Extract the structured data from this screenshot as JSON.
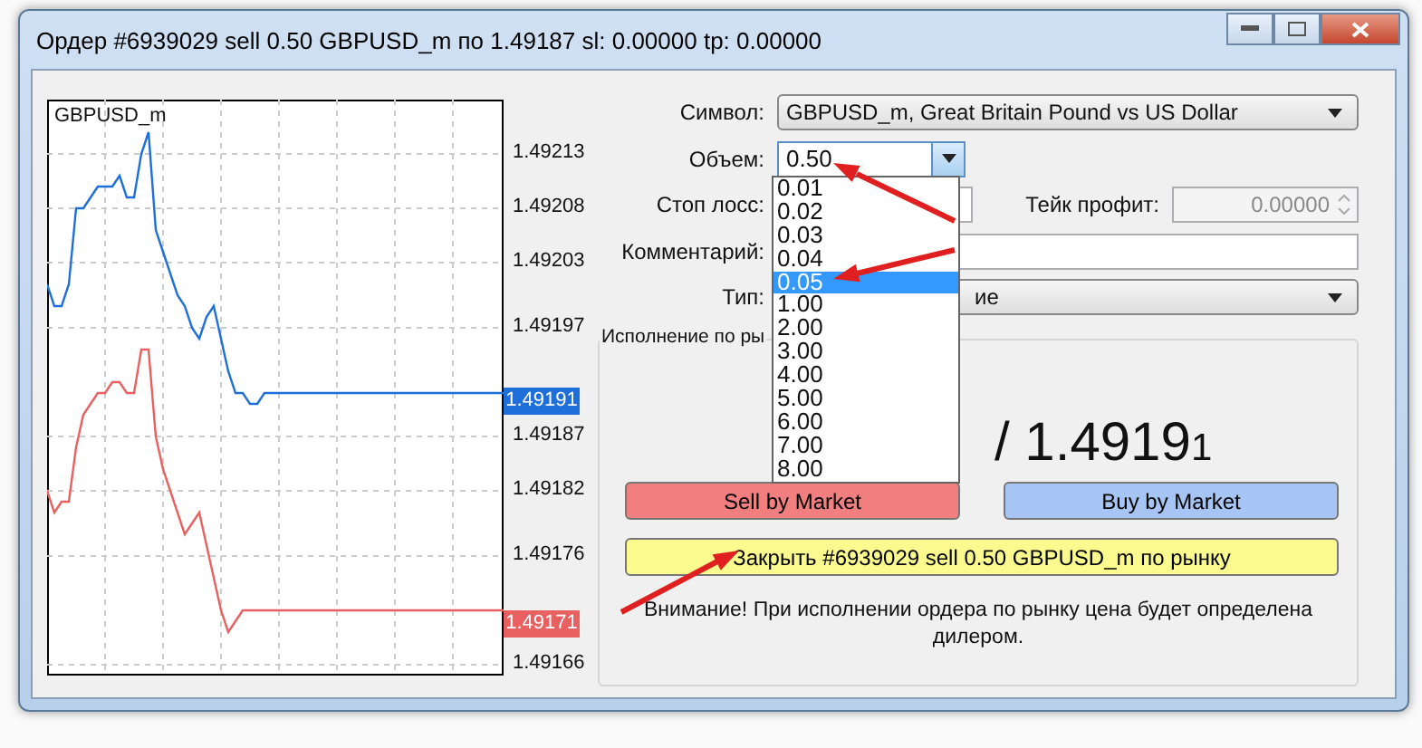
{
  "window": {
    "title": "Ордер #6939029 sell 0.50 GBPUSD_m по 1.49187 sl: 0.00000 tp: 0.00000"
  },
  "chart": {
    "symbol": "GBPUSD_m",
    "chart_data": {
      "type": "line",
      "grid": true,
      "ylim": [
        1.49165,
        1.49218
      ],
      "yticks": [
        {
          "value": 1.49213,
          "label": "1.49213"
        },
        {
          "value": 1.49208,
          "label": "1.49208"
        },
        {
          "value": 1.49203,
          "label": "1.49203"
        },
        {
          "value": 1.49197,
          "label": "1.49197"
        },
        {
          "value": 1.49187,
          "label": "1.49187"
        },
        {
          "value": 1.49182,
          "label": "1.49182"
        },
        {
          "value": 1.49176,
          "label": "1.49176"
        },
        {
          "value": 1.49166,
          "label": "1.49166"
        }
      ],
      "series": [
        {
          "color": "#1e6fd9",
          "values": [
            1.49201,
            1.49199,
            1.49199,
            1.49201,
            1.49208,
            1.49208,
            1.49209,
            1.4921,
            1.4921,
            1.4921,
            1.49211,
            1.49209,
            1.49209,
            1.49213,
            1.49215,
            1.49206,
            1.49204,
            1.49202,
            1.492,
            1.49199,
            1.49197,
            1.49196,
            1.49198,
            1.49199,
            1.49196,
            1.49193,
            1.49191,
            1.49191,
            1.4919,
            1.4919,
            1.49191,
            1.49191,
            1.49191,
            1.49191,
            1.49191,
            1.49191,
            1.49191,
            1.49191,
            1.49191,
            1.49191,
            1.49191,
            1.49191,
            1.49191,
            1.49191,
            1.49191,
            1.49191,
            1.49191,
            1.49191,
            1.49191,
            1.49191,
            1.49191,
            1.49191,
            1.49191,
            1.49191,
            1.49191,
            1.49191,
            1.49191,
            1.49191,
            1.49191,
            1.49191,
            1.49191,
            1.49191,
            1.49191,
            1.49191
          ]
        },
        {
          "color": "#e86060",
          "values": [
            1.49182,
            1.4918,
            1.49181,
            1.49181,
            1.49186,
            1.49189,
            1.4919,
            1.49191,
            1.49191,
            1.49192,
            1.49192,
            1.49191,
            1.49191,
            1.49195,
            1.49195,
            1.49187,
            1.49184,
            1.49182,
            1.4918,
            1.49178,
            1.49179,
            1.4918,
            1.49177,
            1.49174,
            1.49171,
            1.49169,
            1.4917,
            1.49171,
            1.49171,
            1.49171,
            1.49171,
            1.49171,
            1.49171,
            1.49171,
            1.49171,
            1.49171,
            1.49171,
            1.49171,
            1.49171,
            1.49171,
            1.49171,
            1.49171,
            1.49171,
            1.49171,
            1.49171,
            1.49171,
            1.49171,
            1.49171,
            1.49171,
            1.49171,
            1.49171,
            1.49171,
            1.49171,
            1.49171,
            1.49171,
            1.49171,
            1.49171,
            1.49171,
            1.49171,
            1.49171,
            1.49171,
            1.49171,
            1.49171,
            1.49171
          ]
        }
      ]
    },
    "price_tags": [
      {
        "text": "1.49191",
        "color": "#1e6fd9"
      },
      {
        "text": "1.49171",
        "color": "#e86060"
      }
    ]
  },
  "form": {
    "symbol_label": "Символ:",
    "symbol_value": "GBPUSD_m, Great Britain Pound vs US Dollar",
    "volume_label": "Объем:",
    "volume_value": "0.50",
    "stop_loss_label": "Стоп лосс:",
    "take_profit_label": "Тейк профит:",
    "take_profit_value": "0.00000",
    "take_profit_disabled": true,
    "comment_label": "Комментарий:",
    "type_label": "Тип:",
    "type_value": "ие"
  },
  "volume_dropdown": [
    {
      "label": "0.01",
      "selected": false
    },
    {
      "label": "0.02",
      "selected": false
    },
    {
      "label": "0.03",
      "selected": false
    },
    {
      "label": "0.04",
      "selected": false
    },
    {
      "label": "0.05",
      "selected": true
    },
    {
      "label": "1.00",
      "selected": false
    },
    {
      "label": "2.00",
      "selected": false
    },
    {
      "label": "3.00",
      "selected": false
    },
    {
      "label": "4.00",
      "selected": false
    },
    {
      "label": "5.00",
      "selected": false
    },
    {
      "label": "6.00",
      "selected": false
    },
    {
      "label": "7.00",
      "selected": false
    },
    {
      "label": "8.00",
      "selected": false
    }
  ],
  "execution": {
    "legend": "Исполнение по ры",
    "price": "/ 1.4919",
    "price_tail": "1",
    "buttons": [
      {
        "label": "Sell by Market",
        "kind": "sell"
      },
      {
        "label": "Buy by Market",
        "kind": "buy"
      },
      {
        "label": "Закрыть #6939029 sell 0.50 GBPUSD_m по рынку",
        "kind": "close"
      }
    ],
    "warning": "Внимание! При исполнении ордера по рынку цена будет определена дилером."
  }
}
